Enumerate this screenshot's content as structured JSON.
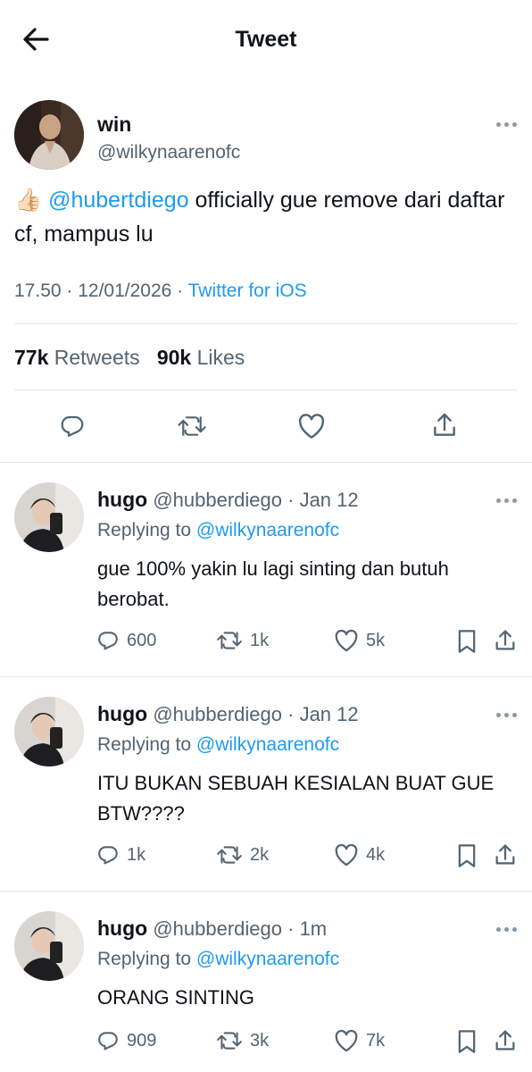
{
  "header": {
    "title": "Tweet"
  },
  "main_tweet": {
    "name": "win",
    "handle": "@wilkynaarenofc",
    "emoji": "👍🏻",
    "mention": "@hubertdiego",
    "text_rest": " officially gue remove dari daftar cf, mampus lu",
    "time": "17.50",
    "date": "12/01/2026",
    "source": "Twitter for iOS",
    "retweets_count": "77k",
    "retweets_label": "Retweets",
    "likes_count": "90k",
    "likes_label": "Likes"
  },
  "replies": [
    {
      "name": "hugo",
      "handle": "@hubberdiego",
      "time": "Jan 12",
      "replying_label": "Replying to",
      "replying_to": "@wilkynaarenofc",
      "text": "gue 100% yakin lu lagi sinting dan butuh berobat.",
      "replies": "600",
      "retweets": "1k",
      "likes": "5k"
    },
    {
      "name": "hugo",
      "handle": "@hubberdiego",
      "time": "Jan 12",
      "replying_label": "Replying to",
      "replying_to": "@wilkynaarenofc",
      "text": "ITU BUKAN SEBUAH KESIALAN BUAT GUE BTW????",
      "replies": "1k",
      "retweets": "2k",
      "likes": "4k"
    },
    {
      "name": "hugo",
      "handle": "@hubberdiego",
      "time": "1m",
      "replying_label": "Replying to",
      "replying_to": "@wilkynaarenofc",
      "text": "ORANG SINTING",
      "replies": "909",
      "retweets": "3k",
      "likes": "7k"
    }
  ],
  "colors": {
    "accent": "#1d9bf0",
    "secondary_text": "#536471",
    "primary_text": "#0f1419",
    "divider": "#e1e6ea"
  },
  "icons": [
    "back-arrow-icon",
    "more-icon",
    "reply-icon",
    "retweet-icon",
    "like-icon",
    "share-icon",
    "bookmark-icon"
  ]
}
